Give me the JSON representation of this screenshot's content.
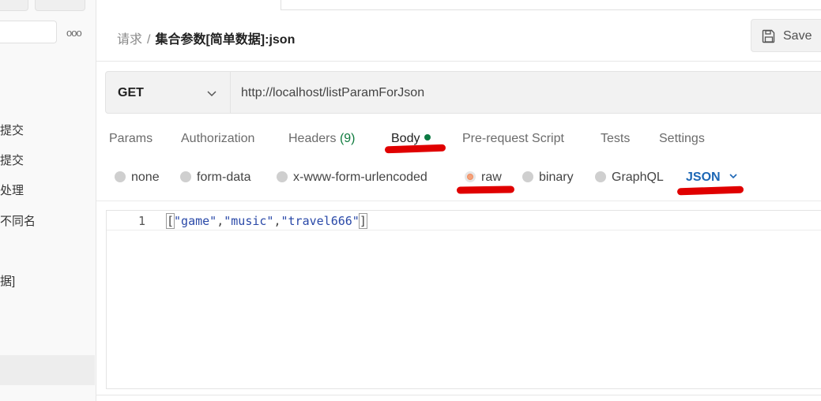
{
  "sidebar": {
    "more_icon": "more-horizontal-icon",
    "more_glyph": "ooo",
    "items": [
      "提交",
      "提交",
      "处理",
      "不同名",
      "",
      "据]"
    ]
  },
  "breadcrumb": {
    "parent": "请求",
    "separator": "/",
    "current": "集合参数[简单数据]:json"
  },
  "save": {
    "label": "Save",
    "icon": "save-icon"
  },
  "request": {
    "method": "GET",
    "url": "http://localhost/listParamForJson"
  },
  "tabs": {
    "params": "Params",
    "authorization": "Authorization",
    "headers": "Headers",
    "headers_count": "(9)",
    "body": "Body",
    "prerequest": "Pre-request Script",
    "tests": "Tests",
    "settings": "Settings"
  },
  "body_types": {
    "none": "none",
    "form_data": "form-data",
    "urlencoded": "x-www-form-urlencoded",
    "raw": "raw",
    "binary": "binary",
    "graphql": "GraphQL",
    "selected": "raw",
    "language": "JSON"
  },
  "editor": {
    "line_number": "1",
    "code_open": "[",
    "strings": [
      "\"game\"",
      "\"music\"",
      "\"travel666\""
    ],
    "comma": ",",
    "code_close": "]"
  },
  "colors": {
    "accent_blue": "#1d67b5",
    "status_green": "#0c7a43",
    "annotation_red": "#e00000",
    "radio_selected": "#f08a5d"
  }
}
